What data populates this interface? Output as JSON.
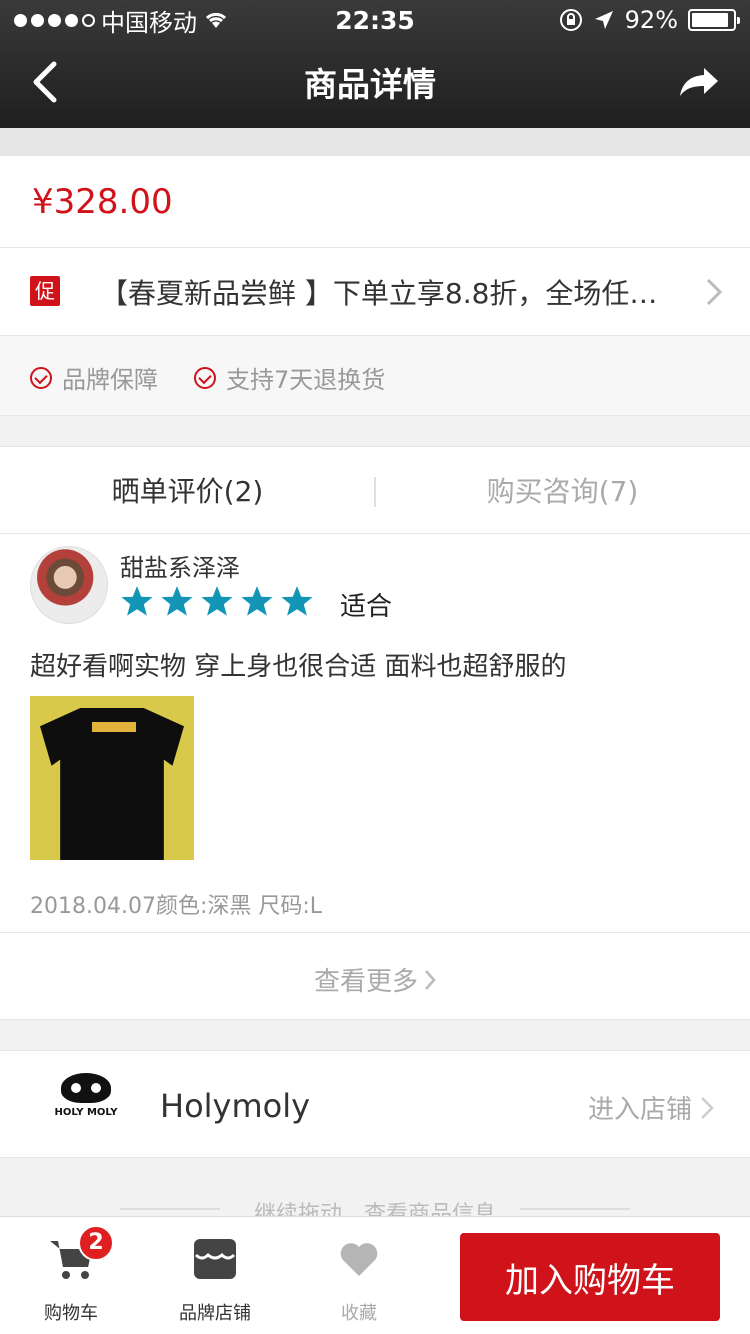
{
  "status_bar": {
    "carrier": "中国移动",
    "time": "22:35",
    "battery": "92%"
  },
  "nav": {
    "title": "商品详情"
  },
  "product": {
    "price": "¥328.00",
    "promo_tag": "促",
    "promo_text": "【春夏新品尝鲜 】下单立享8.8折，全场任…",
    "guarantees": [
      "品牌保障",
      "支持7天退换货"
    ]
  },
  "tabs": [
    {
      "label": "晒单评价(2)",
      "active": true
    },
    {
      "label": "购买咨询(7)",
      "active": false
    }
  ],
  "review": {
    "user": "甜盐系泽泽",
    "rating": 5,
    "fit": "适合",
    "text": "超好看啊实物 穿上身也很合适 面料也超舒服的",
    "meta": "2018.04.07颜色:深黑  尺码:L"
  },
  "more": {
    "label": "查看更多"
  },
  "store": {
    "logo_text": "HOLY MOLY",
    "name": "Holymoly",
    "enter_label": "进入店铺"
  },
  "continue_hint": "继续拖动，查看商品信息",
  "bottom_bar": {
    "cart_label": "购物车",
    "cart_badge": "2",
    "store_label": "品牌店铺",
    "favorite_label": "收藏",
    "add_to_cart": "加入购物车"
  },
  "colors": {
    "accent": "#d0121b",
    "star": "#1396b5"
  }
}
